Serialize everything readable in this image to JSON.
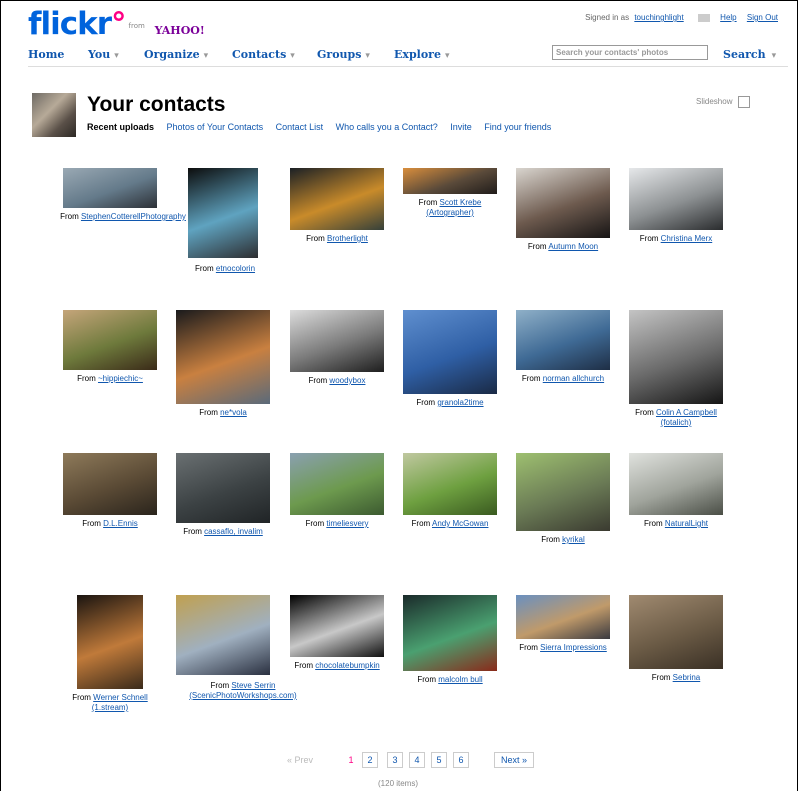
{
  "header": {
    "logo_text": "flickr",
    "logo_from": "from",
    "logo_yahoo": "YAHOO!",
    "signed_in_label": "Signed in as",
    "username": "touchinghlight",
    "help": "Help",
    "sign_out": "Sign Out"
  },
  "nav": {
    "items": [
      "Home",
      "You",
      "Organize",
      "Contacts",
      "Groups",
      "Explore"
    ],
    "search_placeholder": "Search your contacts' photos",
    "search_button": "Search"
  },
  "page": {
    "title": "Your contacts",
    "subnav": [
      "Recent uploads",
      "Photos of Your Contacts",
      "Contact List",
      "Who calls you a Contact?",
      "Invite",
      "Find your friends"
    ],
    "slideshow": "Slideshow"
  },
  "caption_prefix": "From",
  "photos": [
    {
      "author": "StephenCotterellPhotography",
      "colors": [
        "#9aa9b4",
        "#647a8a",
        "#2c3036"
      ]
    },
    {
      "author": "etnocolorin",
      "colors": [
        "#0c0d0d",
        "#5fa3c0",
        "#2d2d30"
      ]
    },
    {
      "author": "Brotherlight",
      "colors": [
        "#1b2025",
        "#c98b2a",
        "#35403a"
      ]
    },
    {
      "author": "Scott Krebe (Artographer)",
      "colors": [
        "#d98e3c",
        "#5a4a3a",
        "#201c1a"
      ]
    },
    {
      "author": "Autumn Moon",
      "colors": [
        "#d9d5cf",
        "#6d5a4e",
        "#161414"
      ]
    },
    {
      "author": "Christina Merx",
      "colors": [
        "#e6e8ea",
        "#8c9092",
        "#2a2c2e"
      ]
    },
    {
      "author": "~hippiechic~",
      "colors": [
        "#c5a57a",
        "#6e7a3c",
        "#3a2a18"
      ]
    },
    {
      "author": "ne*vola",
      "colors": [
        "#1a1a1c",
        "#c98040",
        "#5a6a7a"
      ]
    },
    {
      "author": "woodybox",
      "colors": [
        "#dcdcdc",
        "#7a7a7a",
        "#1e1e1e"
      ]
    },
    {
      "author": "granola2time",
      "colors": [
        "#5f8fcf",
        "#2f5fa5",
        "#1a2a45"
      ]
    },
    {
      "author": "norman allchurch",
      "colors": [
        "#8fb0c8",
        "#3f6a95",
        "#1e2e45"
      ]
    },
    {
      "author": "Colin A Campbell (fotalich)",
      "colors": [
        "#c4c4c4",
        "#6a6a6a",
        "#151515"
      ]
    },
    {
      "author": "D.L.Ennis",
      "colors": [
        "#8e7a5a",
        "#5a4a35",
        "#2a241c"
      ]
    },
    {
      "author": "cassaflo, invalim",
      "colors": [
        "#6a7072",
        "#3c4244",
        "#202426"
      ]
    },
    {
      "author": "timeliesvery",
      "colors": [
        "#8aa0b0",
        "#6d9a4e",
        "#3c5a30"
      ]
    },
    {
      "author": "Andy McGowan",
      "colors": [
        "#c0c8a0",
        "#6ea040",
        "#3a5a20"
      ]
    },
    {
      "author": "kyrikal",
      "colors": [
        "#9ec070",
        "#6a7a55",
        "#3a3a30"
      ]
    },
    {
      "author": "NaturalLight",
      "colors": [
        "#e0e2de",
        "#a0a49c",
        "#4a4e46"
      ]
    },
    {
      "author": "Werner Schnell (1.stream)",
      "colors": [
        "#1a1410",
        "#c07a3a",
        "#3a2a1a"
      ]
    },
    {
      "author": "Steve Serrin (ScenicPhotoWorkshops.com)",
      "colors": [
        "#c0a050",
        "#a0b0c0",
        "#2a3040"
      ]
    },
    {
      "author": "chocolatebumpkin",
      "colors": [
        "#000000",
        "#c8c8c8",
        "#101010"
      ]
    },
    {
      "author": "malcolm bull",
      "colors": [
        "#1a2a2a",
        "#4aa070",
        "#8a2a1a"
      ]
    },
    {
      "author": "Sierra Impressions",
      "colors": [
        "#6a90c0",
        "#c09a6a",
        "#3a3a40"
      ]
    },
    {
      "author": "Sebrina",
      "colors": [
        "#a08a70",
        "#6a5a45",
        "#3a3025"
      ]
    }
  ],
  "pagination": {
    "prev": "« Prev",
    "pages": [
      "1",
      "2",
      "3",
      "4",
      "5",
      "6"
    ],
    "current": "1",
    "next": "Next »",
    "count": "(120 items)"
  },
  "colors": {
    "link": "#1057ae",
    "flickr_blue": "#0063dc",
    "flickr_pink": "#ff0084"
  }
}
